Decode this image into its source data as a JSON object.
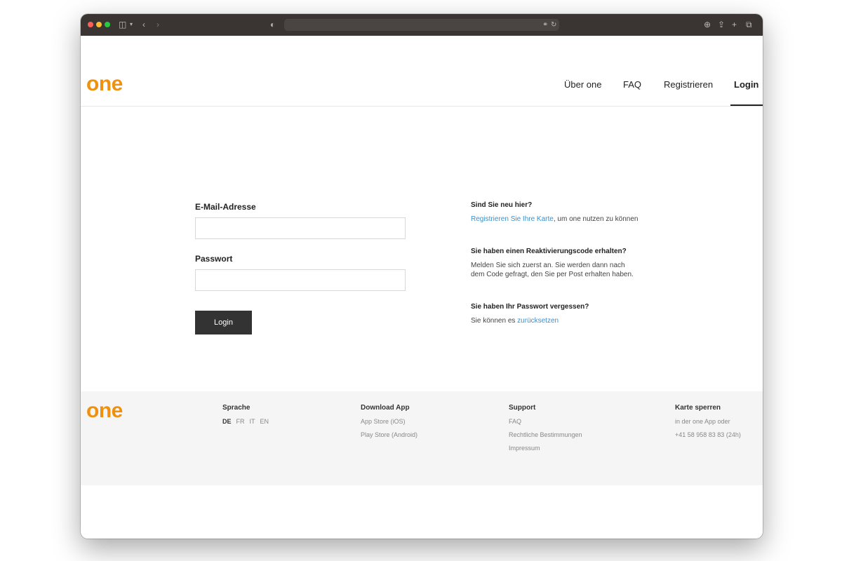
{
  "nav": {
    "logo": "one",
    "items": [
      "Über one",
      "FAQ",
      "Registrieren",
      "Login"
    ]
  },
  "form": {
    "email_label": "E-Mail-Adresse",
    "email_value": "",
    "password_label": "Passwort",
    "password_value": "",
    "login_button": "Login"
  },
  "info": {
    "new_title": "Sind Sie neu hier?",
    "new_link": "Registrieren Sie Ihre Karte",
    "new_text": ", um one nutzen zu können",
    "react_title": "Sie haben einen Reaktivierungscode erhalten?",
    "react_text": "Melden Sie sich zuerst an. Sie werden dann nach dem Code gefragt, den Sie per Post erhalten haben.",
    "forgot_title": "Sie haben Ihr Passwort vergessen?",
    "forgot_text": "Sie können es ",
    "forgot_link": "zurücksetzen"
  },
  "footer": {
    "logo": "one",
    "language_title": "Sprache",
    "languages": [
      "DE",
      "FR",
      "IT",
      "EN"
    ],
    "app_title": "Download App",
    "app_items": [
      "App Store (iOS)",
      "Play Store (Android)"
    ],
    "support_title": "Support",
    "support_items": [
      "FAQ",
      "Rechtliche Bestimmungen",
      "Impressum"
    ],
    "block_title": "Karte sperren",
    "block_items": [
      "in der one App oder",
      "+41 58 958 83 83 (24h)"
    ]
  },
  "colors": {
    "brand": "#f0900f",
    "link": "#3e8fc7",
    "button": "#333333",
    "footer_bg": "#f5f5f5",
    "window_toolbar": "#3a3433"
  },
  "icons": [
    "close-dot",
    "minimize-dot",
    "zoom-dot",
    "sidebar-icon",
    "chevron-down-icon",
    "back-icon",
    "forward-icon",
    "shield-icon",
    "translate-icon",
    "reload-icon",
    "download-icon",
    "share-icon",
    "new-tab-icon",
    "tabs-overview-icon"
  ]
}
